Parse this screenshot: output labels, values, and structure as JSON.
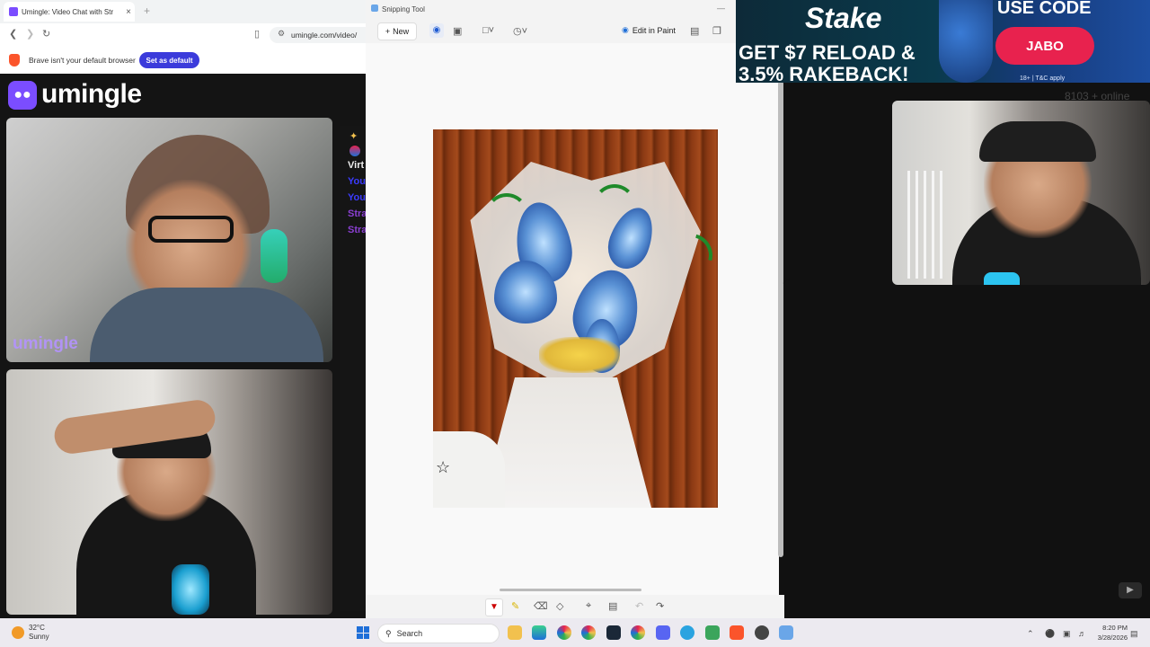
{
  "browser": {
    "tab_title": "Umingle: Video Chat with Str",
    "tab_close": "×",
    "new_tab": "+",
    "url": "umingle.com/video/",
    "infobar_text": "Brave isn't your default browser",
    "set_default": "Set as default"
  },
  "site": {
    "logo": "umingle",
    "watermark": "umingle",
    "chat_lines": [
      {
        "text": "Virt",
        "color": "#ffffff"
      },
      {
        "text": "You",
        "color": "#3b3bff"
      },
      {
        "text": "You",
        "color": "#3b3bff"
      },
      {
        "text": "Stra",
        "color": "#8a3fd1"
      },
      {
        "text": "Stra",
        "color": "#8a3fd1"
      }
    ]
  },
  "snipping_tool": {
    "title": "Snipping Tool",
    "new": "New",
    "edit_in_paint": "Edit in Paint"
  },
  "ad": {
    "brand": "Stake",
    "line1": "GET $7 RELOAD &",
    "line2": "3.5% RAKEBACK!",
    "use_code": "USE CODE",
    "code": "JABO",
    "terms": "18+ | T&C apply"
  },
  "online": "8103 + online",
  "taskbar": {
    "temp": "32°C",
    "condition": "Sunny",
    "search": "Search",
    "time": "8:20 PM",
    "date": "3/28/2026"
  },
  "colors": {
    "accent": "#7b4dff",
    "brave": "#fb542b",
    "ad_button": "#e8224e"
  }
}
